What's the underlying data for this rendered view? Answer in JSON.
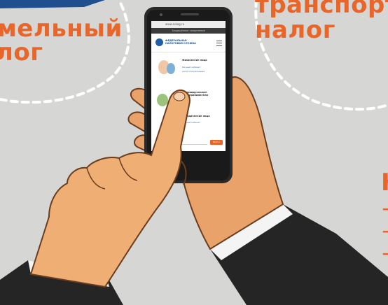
{
  "poster": {
    "left_word_1": "мельный",
    "left_word_2": "лог",
    "right_word_1": "транспорт",
    "right_word_2": "налог",
    "right_edge_letter": "Н",
    "dashes": [
      "–",
      "–",
      "–"
    ]
  },
  "phone": {
    "url": "www.nalog.ru",
    "secure_banner": "Защищённое соединение",
    "site_logo_text": "ФЕДЕРАЛЬНАЯ НАЛОГОВАЯ СЛУЖБА",
    "card_1_title": "Физические лица",
    "card_1_link_1": "Личный кабинет",
    "card_1_link_2": "налогоплательщика",
    "card_2_title": "Индивидуальные предприниматели",
    "card_3_title": "Юридические лица",
    "card_3_link": "Личный кабинет",
    "go_button": "Войти"
  },
  "colors": {
    "accent": "#e9662a",
    "background": "#d6d6d4",
    "skin": "#e9a26a",
    "sleeve": "#252525",
    "phone_body": "#2a2a2a"
  }
}
